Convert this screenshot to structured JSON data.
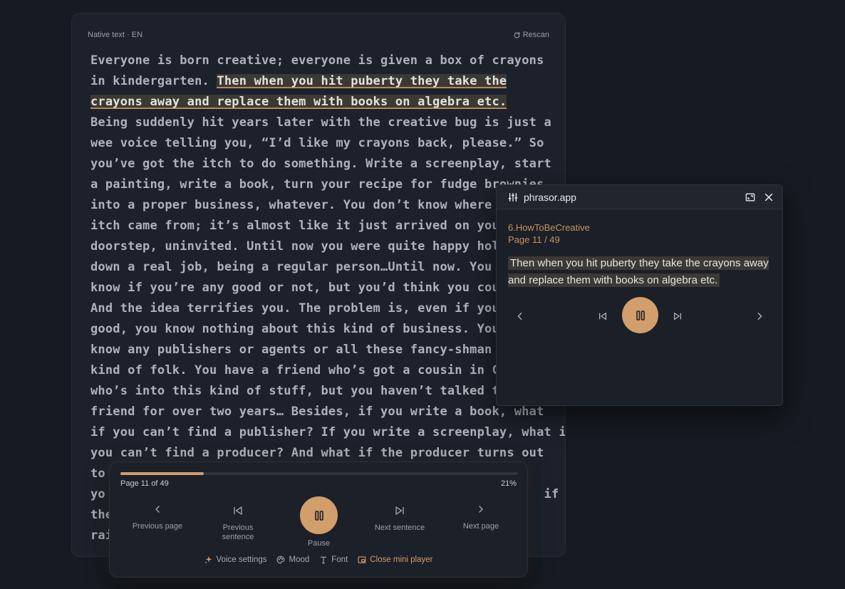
{
  "reader": {
    "label": "Native text · EN",
    "rescan_label": "Rescan",
    "lines": [
      {
        "pre": "Everyone is born creative; everyone is given a box of crayons",
        "hl": "",
        "post": ""
      },
      {
        "pre": "in kindergarten. ",
        "hl": "Then when you hit puberty they take the",
        "post": ""
      },
      {
        "pre": "",
        "hl": "crayons away and replace them with books on algebra etc.",
        "post": ""
      },
      {
        "pre": "Being suddenly hit years later with the creative bug is just a",
        "hl": "",
        "post": ""
      },
      {
        "pre": "wee voice telling you, “I’d like my crayons back, please.” So",
        "hl": "",
        "post": ""
      },
      {
        "pre": "you’ve got the itch to do something. Write a screenplay, start",
        "hl": "",
        "post": ""
      },
      {
        "pre": "a painting, write a book, turn your recipe for fudge brownies",
        "hl": "",
        "post": ""
      },
      {
        "pre": "into a proper business, whatever. You don’t know where",
        "hl": "",
        "post": ""
      },
      {
        "pre": "itch came from; it’s almost like it just arrived on your",
        "hl": "",
        "post": ""
      },
      {
        "pre": "doorstep, uninvited. Until now you were quite happy hol",
        "hl": "",
        "post": ""
      },
      {
        "pre": "down a real job, being a regular person…Until now. You",
        "hl": "",
        "post": ""
      },
      {
        "pre": "know if you’re any good or not, but you’d think you cou",
        "hl": "",
        "post": ""
      },
      {
        "pre": "And the idea terrifies you. The problem is, even if you",
        "hl": "",
        "post": ""
      },
      {
        "pre": "good, you know nothing about this kind of business. You",
        "hl": "",
        "post": ""
      },
      {
        "pre": "know any publishers or agents or all these fancy-shman",
        "hl": "",
        "post": ""
      },
      {
        "pre": "kind of folk. You have a friend who’s got a cousin in Ca",
        "hl": "",
        "post": ""
      },
      {
        "pre": "who’s into this kind of stuff, but you haven’t talked to",
        "hl": "",
        "post": ""
      },
      {
        "pre": "friend for over two years… Besides, if you write a book, what",
        "hl": "",
        "post": ""
      },
      {
        "pre": "if you can’t find a publisher? If you write a screenplay, what if",
        "hl": "",
        "post": ""
      },
      {
        "pre": "you can’t find a producer? And what if the producer turns out",
        "hl": "",
        "post": ""
      },
      {
        "pre": "to",
        "hl": "",
        "post": ""
      },
      {
        "pre": "yo                                                           if",
        "hl": "",
        "post": ""
      },
      {
        "pre": "the",
        "hl": "",
        "post": ""
      },
      {
        "pre": "rai",
        "hl": "",
        "post": ""
      }
    ]
  },
  "panel": {
    "app_name": "phrasor.app",
    "doc_name": "6.HowToBeCreative",
    "page_text": "Page 11 / 49",
    "sentence": "Then when you hit puberty they take the crayons away and replace them with books on algebra etc."
  },
  "mini_player": {
    "progress": 0.21,
    "page_text": "Page 11 of 49",
    "percent_text": "21%",
    "prev_page": "Previous page",
    "prev_sentence": "Previous sentence",
    "pause": "Pause",
    "next_sentence": "Next sentence",
    "next_page": "Next page",
    "tools": {
      "voice": "Voice settings",
      "mood": "Mood",
      "font": "Font",
      "close": "Close mini player"
    }
  },
  "colors": {
    "accent": "#d19e6c",
    "background": "#161a22",
    "highlight": "#3b3933"
  }
}
